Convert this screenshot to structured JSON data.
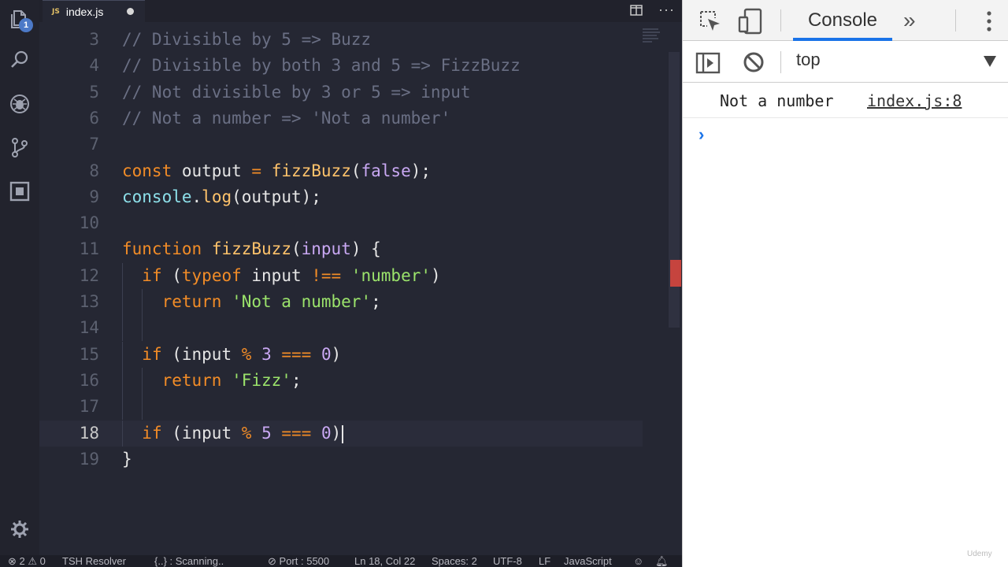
{
  "editor": {
    "tab": {
      "icon_text": "JS",
      "label": "index.js"
    },
    "activity_badge": "1",
    "current_line": 18,
    "lines": [
      {
        "n": "3",
        "tokens": [
          {
            "t": "// Divisible by 5 => Buzz",
            "c": "com"
          }
        ]
      },
      {
        "n": "4",
        "tokens": [
          {
            "t": "// Divisible by both 3 and 5 => FizzBuzz",
            "c": "com"
          }
        ]
      },
      {
        "n": "5",
        "tokens": [
          {
            "t": "// Not divisible by 3 or 5 => input",
            "c": "com"
          }
        ]
      },
      {
        "n": "6",
        "tokens": [
          {
            "t": "// Not a number => 'Not a number'",
            "c": "com"
          }
        ]
      },
      {
        "n": "7",
        "tokens": []
      },
      {
        "n": "8",
        "tokens": [
          {
            "t": "const",
            "c": "kw"
          },
          {
            "t": " output ",
            "c": "plain"
          },
          {
            "t": "=",
            "c": "op"
          },
          {
            "t": " ",
            "c": "plain"
          },
          {
            "t": "fizzBuzz",
            "c": "fn"
          },
          {
            "t": "(",
            "c": "plain"
          },
          {
            "t": "false",
            "c": "par"
          },
          {
            "t": ");",
            "c": "plain"
          }
        ]
      },
      {
        "n": "9",
        "tokens": [
          {
            "t": "console",
            "c": "obj"
          },
          {
            "t": ".",
            "c": "plain"
          },
          {
            "t": "log",
            "c": "fn"
          },
          {
            "t": "(output);",
            "c": "plain"
          }
        ]
      },
      {
        "n": "10",
        "tokens": []
      },
      {
        "n": "11",
        "tokens": [
          {
            "t": "function",
            "c": "kw"
          },
          {
            "t": " ",
            "c": "plain"
          },
          {
            "t": "fizzBuzz",
            "c": "fn"
          },
          {
            "t": "(",
            "c": "plain"
          },
          {
            "t": "input",
            "c": "par"
          },
          {
            "t": ") {",
            "c": "plain"
          }
        ]
      },
      {
        "n": "12",
        "tokens": [
          {
            "t": "  ",
            "c": "plain"
          },
          {
            "t": "if",
            "c": "kw"
          },
          {
            "t": " (",
            "c": "plain"
          },
          {
            "t": "typeof",
            "c": "kw"
          },
          {
            "t": " input ",
            "c": "plain"
          },
          {
            "t": "!==",
            "c": "op"
          },
          {
            "t": " ",
            "c": "plain"
          },
          {
            "t": "'number'",
            "c": "str"
          },
          {
            "t": ")",
            "c": "plain"
          }
        ]
      },
      {
        "n": "13",
        "tokens": [
          {
            "t": "    ",
            "c": "plain"
          },
          {
            "t": "return",
            "c": "kw"
          },
          {
            "t": " ",
            "c": "plain"
          },
          {
            "t": "'Not a number'",
            "c": "str"
          },
          {
            "t": ";",
            "c": "plain"
          }
        ]
      },
      {
        "n": "14",
        "tokens": []
      },
      {
        "n": "15",
        "tokens": [
          {
            "t": "  ",
            "c": "plain"
          },
          {
            "t": "if",
            "c": "kw"
          },
          {
            "t": " (input ",
            "c": "plain"
          },
          {
            "t": "%",
            "c": "op"
          },
          {
            "t": " ",
            "c": "plain"
          },
          {
            "t": "3",
            "c": "num"
          },
          {
            "t": " ",
            "c": "plain"
          },
          {
            "t": "===",
            "c": "op"
          },
          {
            "t": " ",
            "c": "plain"
          },
          {
            "t": "0",
            "c": "num"
          },
          {
            "t": ")",
            "c": "plain"
          }
        ]
      },
      {
        "n": "16",
        "tokens": [
          {
            "t": "    ",
            "c": "plain"
          },
          {
            "t": "return",
            "c": "kw"
          },
          {
            "t": " ",
            "c": "plain"
          },
          {
            "t": "'Fizz'",
            "c": "str"
          },
          {
            "t": ";",
            "c": "plain"
          }
        ]
      },
      {
        "n": "17",
        "tokens": []
      },
      {
        "n": "18",
        "tokens": [
          {
            "t": "  ",
            "c": "plain"
          },
          {
            "t": "if",
            "c": "kw"
          },
          {
            "t": " (input ",
            "c": "plain"
          },
          {
            "t": "%",
            "c": "op"
          },
          {
            "t": " ",
            "c": "plain"
          },
          {
            "t": "5",
            "c": "num"
          },
          {
            "t": " ",
            "c": "plain"
          },
          {
            "t": "===",
            "c": "op"
          },
          {
            "t": " ",
            "c": "plain"
          },
          {
            "t": "0",
            "c": "num"
          },
          {
            "t": ")",
            "c": "plain"
          }
        ]
      },
      {
        "n": "19",
        "tokens": [
          {
            "t": "}",
            "c": "plain"
          }
        ]
      }
    ]
  },
  "status_bar": {
    "errors": "2",
    "warnings": "0",
    "resolver": "TSH Resolver",
    "scanning": "{..} : Scanning..",
    "port": "Port : 5500",
    "position": "Ln 18, Col 22",
    "spaces": "Spaces: 2",
    "encoding": "UTF-8",
    "eol": "LF",
    "language": "JavaScript"
  },
  "devtools": {
    "active_tab": "Console",
    "more_tabs": "»",
    "context": "top",
    "messages": [
      {
        "text": "Not a number",
        "source": "index.js:8"
      }
    ],
    "prompt": "›"
  },
  "watermark": "Udemy",
  "colors": {
    "keyword": "#f28c27",
    "function": "#ffc36b",
    "param": "#c9a8f3",
    "string": "#9be36b",
    "comment": "#6a6f84",
    "object": "#8de0ea",
    "console_tab_accent": "#1a73e8"
  }
}
